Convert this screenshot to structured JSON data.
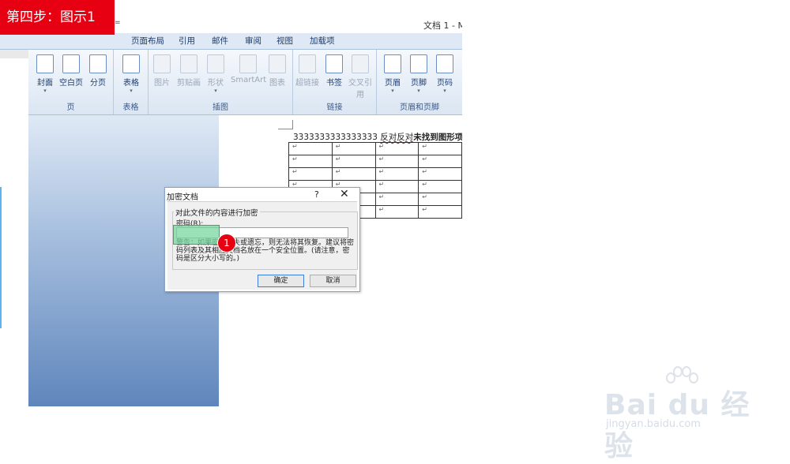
{
  "step_banner": "第四步：图示1",
  "window": {
    "title": "文档 1 - M",
    "qat_arrow": "="
  },
  "ribbon_tabs": [
    "页面布局",
    "引用",
    "邮件",
    "审阅",
    "视图",
    "加载项"
  ],
  "ribbon_groups": {
    "pages": {
      "label": "页",
      "buttons": [
        "封面",
        "空白页",
        "分页"
      ]
    },
    "table": {
      "label": "表格",
      "buttons": [
        "表格"
      ]
    },
    "illustrations": {
      "label": "插图",
      "buttons": [
        "图片",
        "剪贴画",
        "形状",
        "SmartArt",
        "图表"
      ]
    },
    "links": {
      "label": "链接",
      "buttons": [
        "超链接",
        "书签",
        "交叉引用"
      ]
    },
    "header_footer": {
      "label": "页眉和页脚",
      "buttons": [
        "页眉",
        "页脚",
        "页码"
      ]
    }
  },
  "document": {
    "line_prefix": "3333333333333333 ",
    "line_underlined": "反对反对",
    "line_bold": "未找到图形项目",
    "table_rows": 6,
    "table_cols": 4,
    "cell_mark": "↵"
  },
  "dialog": {
    "title": "加密文档",
    "help": "?",
    "close": "✕",
    "group_label": "对此文件的内容进行加密",
    "password_label": "密码(R):",
    "password_value": "",
    "warning": "警告：如果密码丢失或遗忘，则无法将其恢复。建议将密码列表及其相应文档名放在一个安全位置。(请注意，密码是区分大小写的。)",
    "ok_label": "确定",
    "cancel_label": "取消"
  },
  "annotation": {
    "callout_number": "1",
    "accent_color": "#e60012"
  },
  "watermark": {
    "logo": "Bai du 经验",
    "url": "jingyan.baidu.com"
  }
}
